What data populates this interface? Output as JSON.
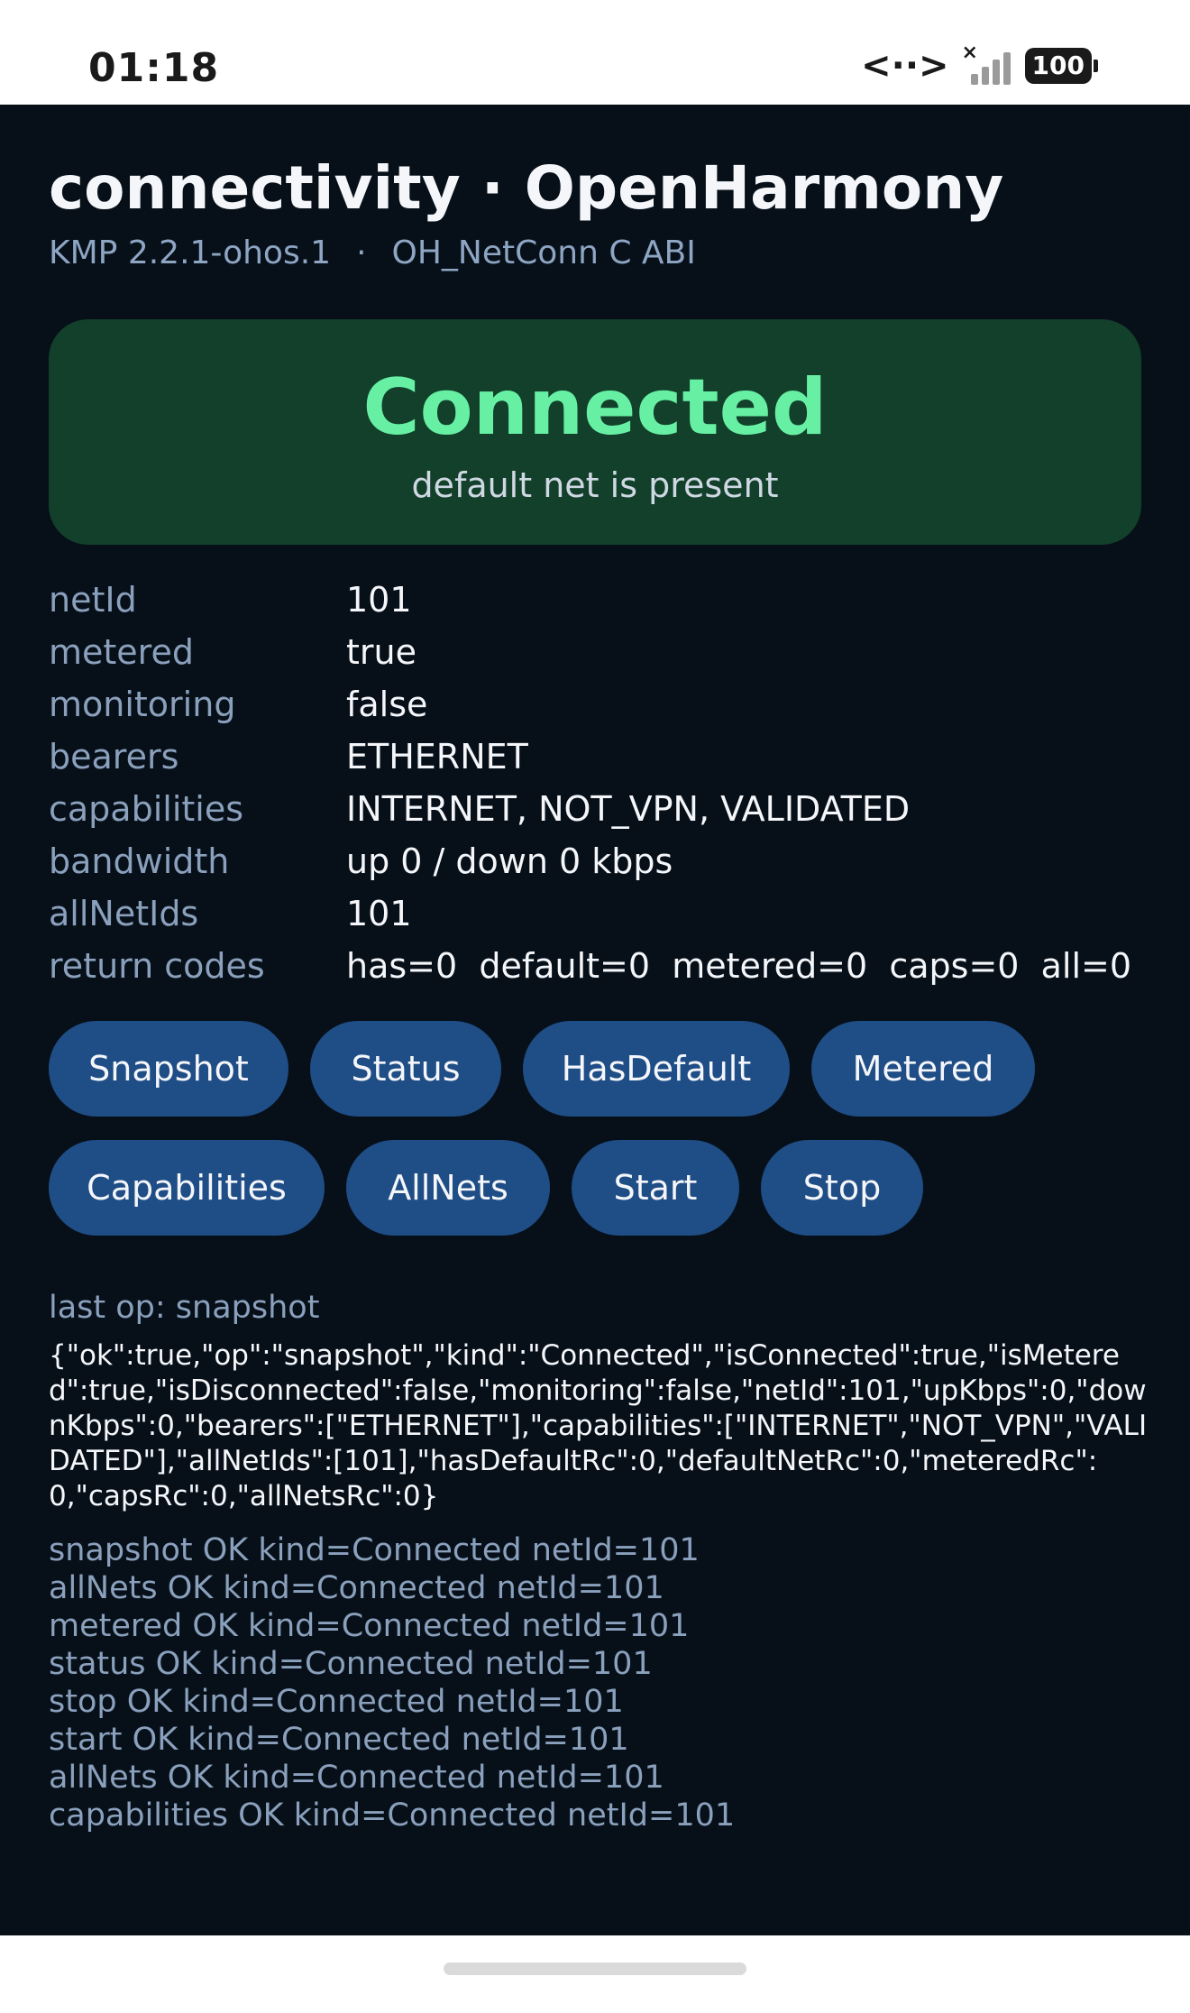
{
  "status_bar": {
    "time": "01:18",
    "battery": "100"
  },
  "header": {
    "title": "connectivity · OpenHarmony",
    "subtitle_left": "KMP 2.2.1-ohos.1",
    "subtitle_sep": "·",
    "subtitle_right": "OH_NetConn C ABI"
  },
  "status_card": {
    "state": "Connected",
    "description": "default net is present",
    "bg_color": "#12402a",
    "text_color": "#67f0a4"
  },
  "details": [
    {
      "key": "netId",
      "value": "101"
    },
    {
      "key": "metered",
      "value": "true"
    },
    {
      "key": "monitoring",
      "value": "false"
    },
    {
      "key": "bearers",
      "value": "ETHERNET"
    },
    {
      "key": "capabilities",
      "value": "INTERNET, NOT_VPN, VALIDATED"
    },
    {
      "key": "bandwidth",
      "value": "up 0 / down 0 kbps"
    },
    {
      "key": "allNetIds",
      "value": "101"
    },
    {
      "key": "return codes",
      "value": "has=0  default=0  metered=0  caps=0  all=0"
    }
  ],
  "buttons": {
    "row1": [
      "Snapshot",
      "Status",
      "HasDefault",
      "Metered"
    ],
    "row2": [
      "Capabilities",
      "AllNets",
      "Start",
      "Stop"
    ],
    "color": "#1f4d86"
  },
  "last_op": "last op: snapshot",
  "json_output": "{\"ok\":true,\"op\":\"snapshot\",\"kind\":\"Connected\",\"isConnected\":true,\"isMetered\":true,\"isDisconnected\":false,\"monitoring\":false,\"netId\":101,\"upKbps\":0,\"downKbps\":0,\"bearers\":[\"ETHERNET\"],\"capabilities\":[\"INTERNET\",\"NOT_VPN\",\"VALIDATED\"],\"allNetIds\":[101],\"hasDefaultRc\":0,\"defaultNetRc\":0,\"meteredRc\":0,\"capsRc\":0,\"allNetsRc\":0}",
  "log": [
    "snapshot OK kind=Connected netId=101",
    "allNets OK kind=Connected netId=101",
    "metered OK kind=Connected netId=101",
    "status OK kind=Connected netId=101",
    "stop OK kind=Connected netId=101",
    "start OK kind=Connected netId=101",
    "allNets OK kind=Connected netId=101",
    "capabilities OK kind=Connected netId=101"
  ]
}
